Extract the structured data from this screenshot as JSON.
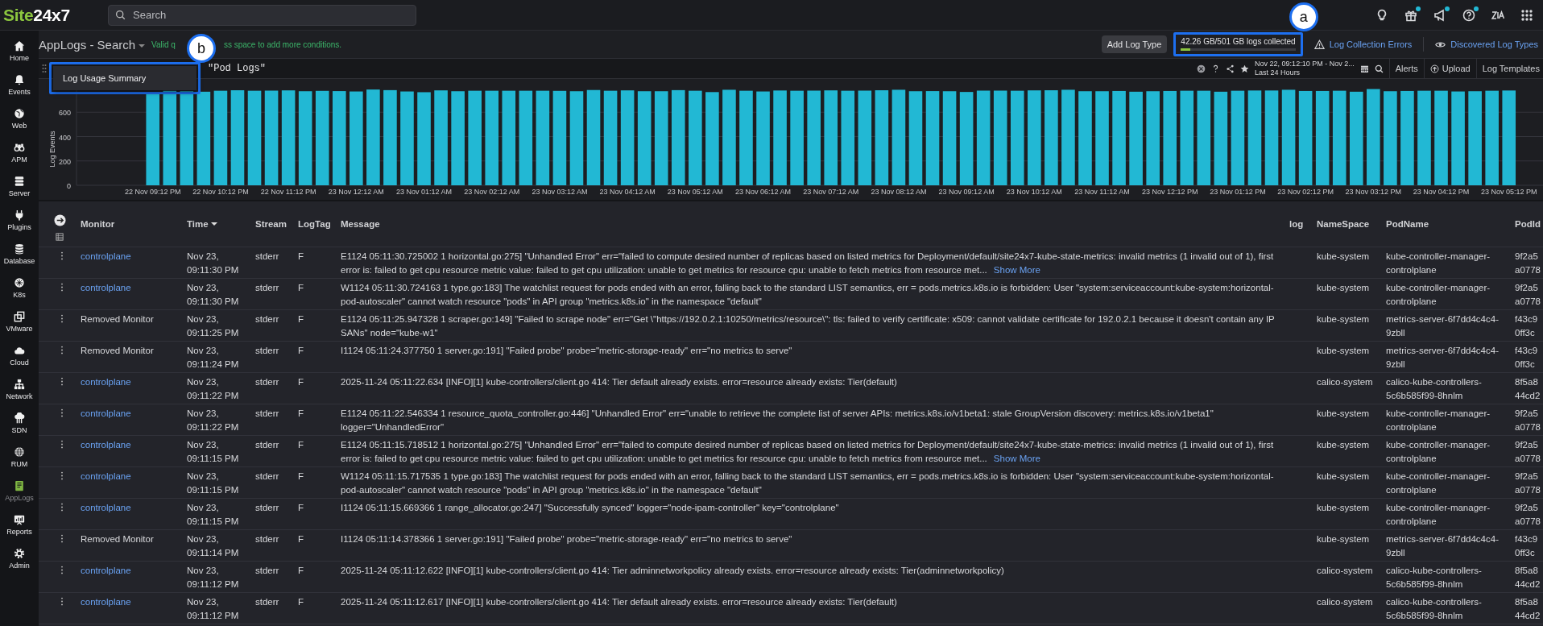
{
  "logo": {
    "accent": "Site",
    "rest": "24x7"
  },
  "search": {
    "placeholder": "Search"
  },
  "toolbar_icons": [
    {
      "dot": false
    },
    {
      "dot": true
    },
    {
      "dot": true
    },
    {
      "dot": true
    },
    {
      "dot": false
    },
    {
      "dot": false
    }
  ],
  "sidebar": {
    "items": [
      {
        "label": "Home",
        "selected": false
      },
      {
        "label": "Events",
        "selected": false
      },
      {
        "label": "Web",
        "selected": false
      },
      {
        "label": "APM",
        "selected": false
      },
      {
        "label": "Server",
        "selected": false
      },
      {
        "label": "Plugins",
        "selected": false
      },
      {
        "label": "Database",
        "selected": false
      },
      {
        "label": "K8s",
        "selected": false
      },
      {
        "label": "VMware",
        "selected": false
      },
      {
        "label": "Cloud",
        "selected": false
      },
      {
        "label": "Network",
        "selected": false
      },
      {
        "label": "SDN",
        "selected": false
      },
      {
        "label": "RUM",
        "selected": false
      },
      {
        "label": "AppLogs",
        "selected": true
      },
      {
        "label": "Reports",
        "selected": false
      },
      {
        "label": "Admin",
        "selected": false
      }
    ]
  },
  "header": {
    "title": "AppLogs - Search",
    "hint_start": "Valid q",
    "hint_end": "ss space to add more conditions.",
    "add_button": "Add Log Type",
    "usage": {
      "text": "42.26 GB/501 GB logs collected",
      "level": 0.084
    },
    "errors_link": "Log Collection Errors",
    "discovered_link": "Discovered Log Types"
  },
  "query": {
    "text": "\"Pod Logs\"",
    "date_range": "Nov 22, 09:12:10 PM - Nov 2...",
    "period": "Last 24 Hours",
    "alerts": "Alerts",
    "upload": "Upload",
    "templates": "Log Templates"
  },
  "menu": {
    "items": [
      "Log Usage Summary"
    ]
  },
  "annotations": [
    {
      "label": "a"
    },
    {
      "label": "b"
    }
  ],
  "chart": {
    "chart_data": {
      "type": "bar",
      "ylabel": "Log Events",
      "grid": true,
      "ylim": [
        0,
        800
      ],
      "yticks": [
        0,
        200,
        400,
        600
      ],
      "categories": [
        null,
        null,
        null,
        null,
        "22 Nov 09:12 PM",
        null,
        null,
        null,
        "22 Nov 10:12 PM",
        null,
        null,
        null,
        "22 Nov 11:12 PM",
        null,
        null,
        null,
        "23 Nov 12:12 AM",
        null,
        null,
        null,
        "23 Nov 01:12 AM",
        null,
        null,
        null,
        "23 Nov 02:12 AM",
        null,
        null,
        null,
        "23 Nov 03:12 AM",
        null,
        null,
        null,
        "23 Nov 04:12 AM",
        null,
        null,
        null,
        "23 Nov 05:12 AM",
        null,
        null,
        null,
        "23 Nov 06:12 AM",
        null,
        null,
        null,
        "23 Nov 07:12 AM",
        null,
        null,
        null,
        "23 Nov 08:12 AM",
        null,
        null,
        null,
        "23 Nov 09:12 AM",
        null,
        null,
        null,
        "23 Nov 10:12 AM",
        null,
        null,
        null,
        "23 Nov 11:12 AM",
        null,
        null,
        null,
        "23 Nov 12:12 PM",
        null,
        null,
        null,
        "23 Nov 01:12 PM",
        null,
        null,
        null,
        "23 Nov 02:12 PM",
        null,
        null,
        null,
        "23 Nov 03:12 PM",
        null,
        null,
        null,
        "23 Nov 04:12 PM",
        null,
        null,
        null,
        "23 Nov 05:12 PM"
      ],
      "values": [
        null,
        null,
        null,
        null,
        760,
        775,
        772,
        768,
        776,
        780,
        776,
        777,
        779,
        772,
        775,
        773,
        770,
        786,
        781,
        770,
        764,
        779,
        772,
        776,
        776,
        776,
        776,
        776,
        775,
        772,
        782,
        776,
        779,
        772,
        772,
        781,
        776,
        765,
        784,
        776,
        770,
        778,
        776,
        777,
        779,
        776,
        777,
        780,
        784,
        772,
        773,
        772,
        766,
        777,
        777,
        776,
        779,
        780,
        784,
        772,
        772,
        774,
        768,
        772,
        774,
        776,
        776,
        768,
        776,
        778,
        778,
        784,
        774,
        774,
        776,
        768,
        790,
        772,
        774,
        776,
        776,
        770,
        772,
        776,
        778
      ]
    }
  },
  "table": {
    "columns": [
      "Monitor",
      "Time",
      "Stream",
      "LogTag",
      "Message",
      "log",
      "NameSpace",
      "PodName",
      "PodId"
    ],
    "rows": [
      {
        "monitor": "controlplane",
        "monitor_link": true,
        "time": "Nov 23, 09:11:30 PM",
        "stream": "stderr",
        "log_tag": "F",
        "message": "E1124 05:11:30.725002 1 horizontal.go:275] \"Unhandled Error\" err=\"failed to compute desired number of replicas based on listed metrics for Deployment/default/site24x7-kube-state-metrics: invalid metrics (1 invalid out of 1), first error is: failed to get cpu resource metric value: failed to get cpu utilization: unable to get metrics for resource cpu: unable to fetch metrics from resource met...",
        "show_more": "Show More",
        "namespace": "kube-system",
        "pod_name": "kube-controller-manager-controlplane",
        "pod_id": [
          "9f2a5",
          "a0778"
        ]
      },
      {
        "monitor": "controlplane",
        "monitor_link": true,
        "time": "Nov 23, 09:11:30 PM",
        "stream": "stderr",
        "log_tag": "F",
        "message": "W1124 05:11:30.724163 1 type.go:183] The watchlist request for pods ended with an error, falling back to the standard LIST semantics, err = pods.metrics.k8s.io is forbidden: User \"system:serviceaccount:kube-system:horizontal-pod-autoscaler\" cannot watch resource \"pods\" in API group \"metrics.k8s.io\" in the namespace \"default\"",
        "namespace": "kube-system",
        "pod_name": "kube-controller-manager-controlplane",
        "pod_id": [
          "9f2a5",
          "a0778"
        ]
      },
      {
        "monitor": "Removed Monitor",
        "monitor_link": false,
        "time": "Nov 23, 09:11:25 PM",
        "stream": "stderr",
        "log_tag": "F",
        "message": "E1124 05:11:25.947328 1 scraper.go:149] \"Failed to scrape node\" err=\"Get \\\"https://192.0.2.1:10250/metrics/resource\\\": tls: failed to verify certificate: x509: cannot validate certificate for 192.0.2.1 because it doesn't contain any IP SANs\" node=\"kube-w1\"",
        "namespace": "kube-system",
        "pod_name": "metrics-server-6f7dd4c4c4-9zbll",
        "pod_id": [
          "f43c9",
          "0ff3c"
        ]
      },
      {
        "monitor": "Removed Monitor",
        "monitor_link": false,
        "time": "Nov 23, 09:11:24 PM",
        "stream": "stderr",
        "log_tag": "F",
        "message": "I1124 05:11:24.377750 1 server.go:191] \"Failed probe\" probe=\"metric-storage-ready\" err=\"no metrics to serve\"",
        "namespace": "kube-system",
        "pod_name": "metrics-server-6f7dd4c4c4-9zbll",
        "pod_id": [
          "f43c9",
          "0ff3c"
        ]
      },
      {
        "monitor": "controlplane",
        "monitor_link": true,
        "time": "Nov 23, 09:11:22 PM",
        "stream": "stderr",
        "log_tag": "F",
        "message": "2025-11-24 05:11:22.634 [INFO][1] kube-controllers/client.go 414: Tier default already exists. error=resource already exists: Tier(default)",
        "namespace": "calico-system",
        "pod_name": "calico-kube-controllers-5c6b585f99-8hnlm",
        "pod_id": [
          "8f5a8",
          "44cd2"
        ]
      },
      {
        "monitor": "controlplane",
        "monitor_link": true,
        "time": "Nov 23, 09:11:22 PM",
        "stream": "stderr",
        "log_tag": "F",
        "message": "E1124 05:11:22.546334 1 resource_quota_controller.go:446] \"Unhandled Error\" err=\"unable to retrieve the complete list of server APIs: metrics.k8s.io/v1beta1: stale GroupVersion discovery: metrics.k8s.io/v1beta1\" logger=\"UnhandledError\"",
        "namespace": "kube-system",
        "pod_name": "kube-controller-manager-controlplane",
        "pod_id": [
          "9f2a5",
          "a0778"
        ]
      },
      {
        "monitor": "controlplane",
        "monitor_link": true,
        "time": "Nov 23, 09:11:15 PM",
        "stream": "stderr",
        "log_tag": "F",
        "message": "E1124 05:11:15.718512 1 horizontal.go:275] \"Unhandled Error\" err=\"failed to compute desired number of replicas based on listed metrics for Deployment/default/site24x7-kube-state-metrics: invalid metrics (1 invalid out of 1), first error is: failed to get cpu resource metric value: failed to get cpu utilization: unable to get metrics for resource cpu: unable to fetch metrics from resource met...",
        "show_more": "Show More",
        "namespace": "kube-system",
        "pod_name": "kube-controller-manager-controlplane",
        "pod_id": [
          "9f2a5",
          "a0778"
        ]
      },
      {
        "monitor": "controlplane",
        "monitor_link": true,
        "time": "Nov 23, 09:11:15 PM",
        "stream": "stderr",
        "log_tag": "F",
        "message": "W1124 05:11:15.717535 1 type.go:183] The watchlist request for pods ended with an error, falling back to the standard LIST semantics, err = pods.metrics.k8s.io is forbidden: User \"system:serviceaccount:kube-system:horizontal-pod-autoscaler\" cannot watch resource \"pods\" in API group \"metrics.k8s.io\" in the namespace \"default\"",
        "namespace": "kube-system",
        "pod_name": "kube-controller-manager-controlplane",
        "pod_id": [
          "9f2a5",
          "a0778"
        ]
      },
      {
        "monitor": "controlplane",
        "monitor_link": true,
        "time": "Nov 23, 09:11:15 PM",
        "stream": "stderr",
        "log_tag": "F",
        "message": "I1124 05:11:15.669366 1 range_allocator.go:247] \"Successfully synced\" logger=\"node-ipam-controller\" key=\"controlplane\"",
        "namespace": "kube-system",
        "pod_name": "kube-controller-manager-controlplane",
        "pod_id": [
          "9f2a5",
          "a0778"
        ]
      },
      {
        "monitor": "Removed Monitor",
        "monitor_link": false,
        "time": "Nov 23, 09:11:14 PM",
        "stream": "stderr",
        "log_tag": "F",
        "message": "I1124 05:11:14.378366 1 server.go:191] \"Failed probe\" probe=\"metric-storage-ready\" err=\"no metrics to serve\"",
        "namespace": "kube-system",
        "pod_name": "metrics-server-6f7dd4c4c4-9zbll",
        "pod_id": [
          "f43c9",
          "0ff3c"
        ]
      },
      {
        "monitor": "controlplane",
        "monitor_link": true,
        "time": "Nov 23, 09:11:12 PM",
        "stream": "stderr",
        "log_tag": "F",
        "message": "2025-11-24 05:11:12.622 [INFO][1] kube-controllers/client.go 414: Tier adminnetworkpolicy already exists. error=resource already exists: Tier(adminnetworkpolicy)",
        "namespace": "calico-system",
        "pod_name": "calico-kube-controllers-5c6b585f99-8hnlm",
        "pod_id": [
          "8f5a8",
          "44cd2"
        ]
      },
      {
        "monitor": "controlplane",
        "monitor_link": true,
        "time": "Nov 23, 09:11:12 PM",
        "stream": "stderr",
        "log_tag": "F",
        "message": "2025-11-24 05:11:12.617 [INFO][1] kube-controllers/client.go 414: Tier default already exists. error=resource already exists: Tier(default)",
        "namespace": "calico-system",
        "pod_name": "calico-kube-controllers-5c6b585f99-8hnlm",
        "pod_id": [
          "8f5a8",
          "44cd2"
        ]
      }
    ]
  }
}
